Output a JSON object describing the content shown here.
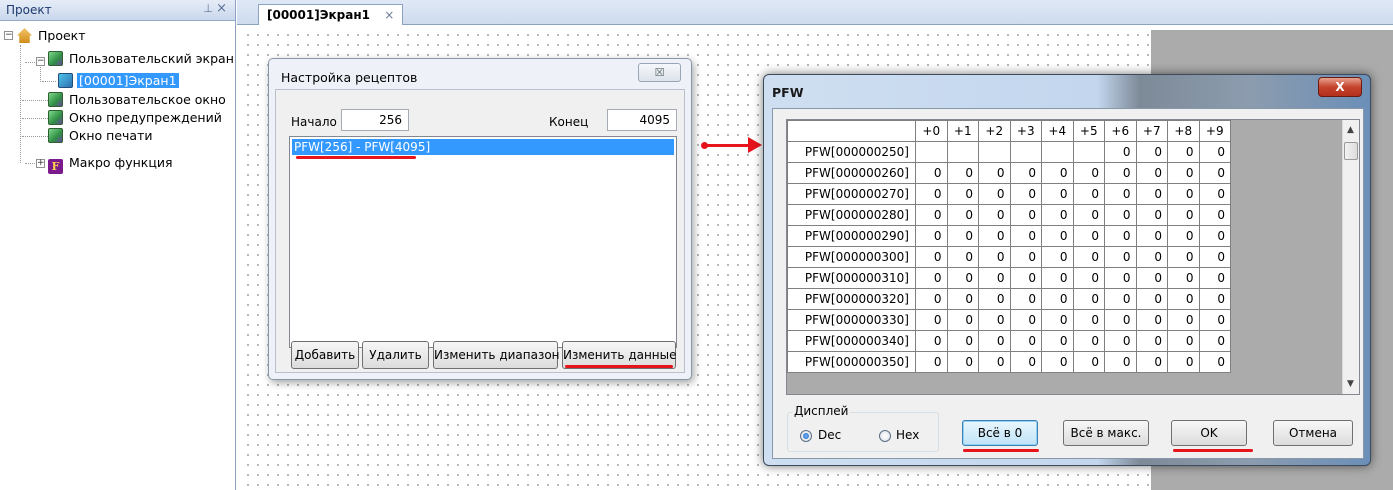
{
  "project_panel": {
    "title": "Проект",
    "pin_icon": "pin-icon",
    "close_glyph": "×",
    "tree": {
      "root": "Проект",
      "user_screen": "Пользовательский экран",
      "screen1": "[00001]Экран1",
      "user_window": "Пользовательское окно",
      "alarm_window": "Окно предупреждений",
      "print_window": "Окно печати",
      "macro": "Макро функция",
      "macro_icon_letter": "F"
    }
  },
  "editor": {
    "tab_label": "[00001]Экран1",
    "tab_close": "×"
  },
  "recipe_dialog": {
    "title": "Настройка рецептов",
    "close_glyph": "☒",
    "start_label": "Начало",
    "start_value": "256",
    "end_label": "Конец",
    "end_value": "4095",
    "list_items": [
      "PFW[256] - PFW[4095]"
    ],
    "buttons": {
      "add": "Добавить",
      "delete": "Удалить",
      "change_range": "Изменить диапазон",
      "change_data": "Изменить данные"
    }
  },
  "pfw_dialog": {
    "title": "PFW",
    "close_glyph": "X",
    "columns": [
      "+0",
      "+1",
      "+2",
      "+3",
      "+4",
      "+5",
      "+6",
      "+7",
      "+8",
      "+9"
    ],
    "rows": [
      {
        "label": "PFW[000000250]",
        "values": [
          "",
          "",
          "",
          "",
          "",
          "",
          "0",
          "0",
          "0",
          "0"
        ]
      },
      {
        "label": "PFW[000000260]",
        "values": [
          "0",
          "0",
          "0",
          "0",
          "0",
          "0",
          "0",
          "0",
          "0",
          "0"
        ]
      },
      {
        "label": "PFW[000000270]",
        "values": [
          "0",
          "0",
          "0",
          "0",
          "0",
          "0",
          "0",
          "0",
          "0",
          "0"
        ]
      },
      {
        "label": "PFW[000000280]",
        "values": [
          "0",
          "0",
          "0",
          "0",
          "0",
          "0",
          "0",
          "0",
          "0",
          "0"
        ]
      },
      {
        "label": "PFW[000000290]",
        "values": [
          "0",
          "0",
          "0",
          "0",
          "0",
          "0",
          "0",
          "0",
          "0",
          "0"
        ]
      },
      {
        "label": "PFW[000000300]",
        "values": [
          "0",
          "0",
          "0",
          "0",
          "0",
          "0",
          "0",
          "0",
          "0",
          "0"
        ]
      },
      {
        "label": "PFW[000000310]",
        "values": [
          "0",
          "0",
          "0",
          "0",
          "0",
          "0",
          "0",
          "0",
          "0",
          "0"
        ]
      },
      {
        "label": "PFW[000000320]",
        "values": [
          "0",
          "0",
          "0",
          "0",
          "0",
          "0",
          "0",
          "0",
          "0",
          "0"
        ]
      },
      {
        "label": "PFW[000000330]",
        "values": [
          "0",
          "0",
          "0",
          "0",
          "0",
          "0",
          "0",
          "0",
          "0",
          "0"
        ]
      },
      {
        "label": "PFW[000000340]",
        "values": [
          "0",
          "0",
          "0",
          "0",
          "0",
          "0",
          "0",
          "0",
          "0",
          "0"
        ]
      },
      {
        "label": "PFW[000000350]",
        "values": [
          "0",
          "0",
          "0",
          "0",
          "0",
          "0",
          "0",
          "0",
          "0",
          "0"
        ]
      }
    ],
    "display_group": "Дисплей",
    "radio_dec": "Dec",
    "radio_hex": "Hex",
    "selected_radio": "Dec",
    "buttons": {
      "all_zero": "Всё в 0",
      "all_max": "Всё в макс.",
      "ok": "OK",
      "cancel": "Отмена"
    }
  },
  "colors": {
    "selection": "#3399ff",
    "annotation_red": "#e8141b"
  }
}
